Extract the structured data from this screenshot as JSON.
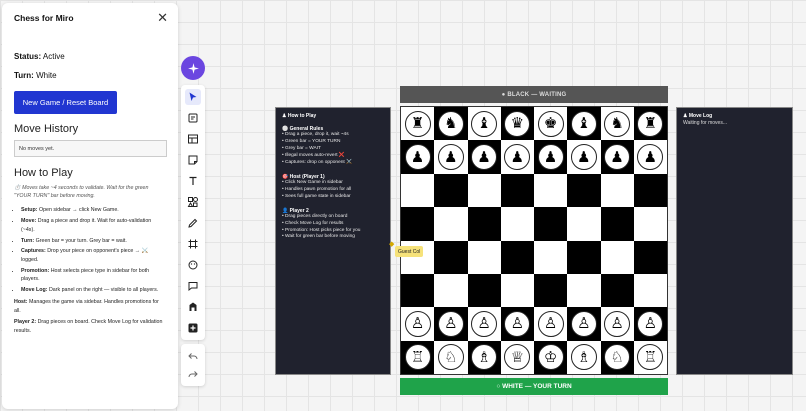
{
  "sidebar": {
    "title": "Chess for Miro",
    "close_glyph": "✕",
    "status_label": "Status:",
    "status_value": "Active",
    "turn_label": "Turn:",
    "turn_value": "White",
    "new_game_label": "New Game / Reset Board",
    "history_title": "Move History",
    "history_empty": "No moves yet.",
    "howto_title": "How to Play",
    "howto_note": "⏱️ Moves take ~4 seconds to validate. Wait for the green \"YOUR TURN\" bar before moving.",
    "rules": [
      {
        "label": "Setup:",
        "text": " Open sidebar → click New Game."
      },
      {
        "label": "Move:",
        "text": " Drag a piece and drop it. Wait for auto-validation (~4s)."
      },
      {
        "label": "Turn:",
        "text": " Green bar = your turn. Grey bar = wait."
      },
      {
        "label": "Captures:",
        "text": " Drop your piece on opponent's piece → ⚔️ logged."
      },
      {
        "label": "Promotion:",
        "text": " Host selects piece type in sidebar for both players."
      },
      {
        "label": "Move Log:",
        "text": " Dark panel on the right — visible to all players."
      }
    ],
    "host_label": "Host:",
    "host_text": " Manages the game via sidebar. Handles promotions for all.",
    "player2_label": "Player 2:",
    "player2_text": " Drag pieces on board. Check Move Log for validation results."
  },
  "toolbar": {
    "icons": [
      "cursor-icon",
      "sticky-template-icon",
      "table-icon",
      "sticky-note-icon",
      "text-icon",
      "shapes-icon",
      "pen-icon",
      "frame-icon",
      "emoji-icon",
      "comment-icon",
      "upload-icon",
      "add-icon"
    ],
    "undo_icon": "undo-icon",
    "redo_icon": "redo-icon"
  },
  "howto_panel": {
    "title": "♟ How to Play",
    "sections": [
      {
        "heading": "⚪ General Rules",
        "lines": [
          "• Drag a piece, drop it, wait ~4s",
          "• Green bar = YOUR TURN",
          "• Grey bar = WAIT",
          "• Illegal moves auto-revert ❌",
          "• Captures: drop on opponent ⚔️"
        ]
      },
      {
        "heading": "🎯 Host (Player 1)",
        "lines": [
          "• Click New Game in sidebar",
          "• Handles pawn promotion for all",
          "• Sees full game state in sidebar"
        ]
      },
      {
        "heading": "👤 Player 2",
        "lines": [
          "• Drag pieces directly on board",
          "• Check Move Log for results",
          "• Promotion: Host picks piece for you",
          "• Wait for green bar before moving"
        ]
      }
    ]
  },
  "movelog_panel": {
    "title": "♟ Move Log",
    "subtitle": "Waiting for moves..."
  },
  "board": {
    "black_bar": "● BLACK — WAITING",
    "white_bar": "○ WHITE — YOUR TURN",
    "ranks": [
      [
        "♜",
        "♞",
        "♝",
        "♛",
        "♚",
        "♝",
        "♞",
        "♜"
      ],
      [
        "♟",
        "♟",
        "♟",
        "♟",
        "♟",
        "♟",
        "♟",
        "♟"
      ],
      [
        "",
        "",
        "",
        "",
        "",
        "",
        "",
        ""
      ],
      [
        "",
        "",
        "",
        "",
        "",
        "",
        "",
        ""
      ],
      [
        "",
        "",
        "",
        "",
        "",
        "",
        "",
        ""
      ],
      [
        "",
        "",
        "",
        "",
        "",
        "",
        "",
        ""
      ],
      [
        "♙",
        "♙",
        "♙",
        "♙",
        "♙",
        "♙",
        "♙",
        "♙"
      ],
      [
        "♖",
        "♘",
        "♗",
        "♕",
        "♔",
        "♗",
        "♘",
        "♖"
      ]
    ],
    "dark_color": "#000000",
    "light_color": "#ffffff"
  },
  "cursor": {
    "guest_label": "Guest Col"
  },
  "colors": {
    "primary_button": "#2136d1",
    "turn_green": "#1fa34a",
    "waiting_grey": "#555555",
    "panel_dark": "#20222e",
    "ai_purple": "#6b46e0"
  }
}
